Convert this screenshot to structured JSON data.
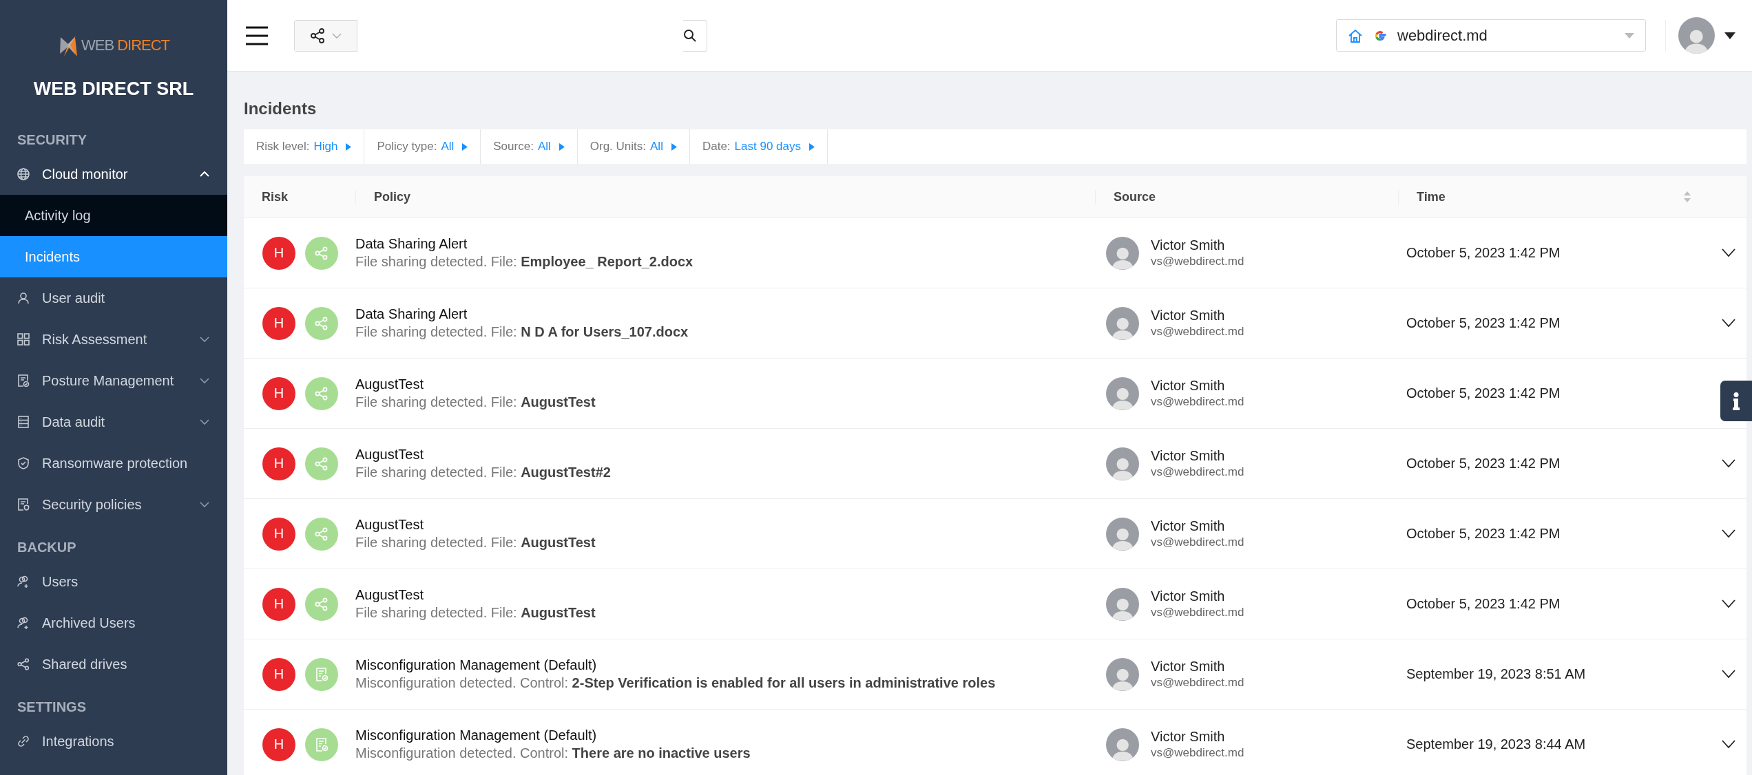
{
  "sidebar": {
    "logo": {
      "word_1": "WEB",
      "word_2": "DIRECT"
    },
    "company": "WEB DIRECT SRL",
    "items": [
      {
        "kind": "header",
        "label": "SECURITY"
      },
      {
        "kind": "item",
        "label": "Cloud monitor",
        "expanded": true
      },
      {
        "kind": "subitem",
        "label": "Activity log",
        "selected": false
      },
      {
        "kind": "subitem",
        "label": "Incidents",
        "selected": true
      },
      {
        "kind": "item",
        "label": "User audit"
      },
      {
        "kind": "item",
        "label": "Risk Assessment",
        "expanded": false
      },
      {
        "kind": "item",
        "label": "Posture Management",
        "expanded": false
      },
      {
        "kind": "item",
        "label": "Data audit",
        "expanded": false
      },
      {
        "kind": "item",
        "label": "Ransomware protection"
      },
      {
        "kind": "item",
        "label": "Security policies",
        "expanded": false
      },
      {
        "kind": "header",
        "label": "BACKUP"
      },
      {
        "kind": "item",
        "label": "Users"
      },
      {
        "kind": "item",
        "label": "Archived Users"
      },
      {
        "kind": "item",
        "label": "Shared drives"
      },
      {
        "kind": "header",
        "label": "SETTINGS"
      },
      {
        "kind": "item",
        "label": "Integrations"
      }
    ]
  },
  "topbar": {
    "domain": "webdirect.md"
  },
  "page_title": "Incidents",
  "filters": [
    {
      "label": "Risk level:",
      "value": "High"
    },
    {
      "label": "Policy type:",
      "value": "All"
    },
    {
      "label": "Source:",
      "value": "All"
    },
    {
      "label": "Org. Units:",
      "value": "All"
    },
    {
      "label": "Date:",
      "value": "Last 90 days"
    }
  ],
  "table": {
    "columns": [
      "Risk",
      "Policy",
      "Source",
      "Time"
    ],
    "rows": [
      {
        "kind": "sharing",
        "risk": "H",
        "title": "Data Sharing Alert",
        "detail": "File sharing detected. File: **Employee_ Report_2.docx**",
        "name": "Victor Smith",
        "email": "vs@webdirect.md",
        "time": "October 5, 2023 1:42 PM"
      },
      {
        "kind": "sharing",
        "risk": "H",
        "title": "Data Sharing Alert",
        "detail": "File sharing detected. File: **N D A for Users_107.docx**",
        "name": "Victor Smith",
        "email": "vs@webdirect.md",
        "time": "October 5, 2023 1:42 PM"
      },
      {
        "kind": "sharing",
        "risk": "H",
        "title": "AugustTest",
        "detail": "File sharing detected. File: **AugustTest**",
        "name": "Victor Smith",
        "email": "vs@webdirect.md",
        "time": "October 5, 2023 1:42 PM"
      },
      {
        "kind": "sharing",
        "risk": "H",
        "title": "AugustTest",
        "detail": "File sharing detected. File: **AugustTest#2**",
        "name": "Victor Smith",
        "email": "vs@webdirect.md",
        "time": "October 5, 2023 1:42 PM"
      },
      {
        "kind": "sharing",
        "risk": "H",
        "title": "AugustTest",
        "detail": "File sharing detected. File: **AugustTest**",
        "name": "Victor Smith",
        "email": "vs@webdirect.md",
        "time": "October 5, 2023 1:42 PM"
      },
      {
        "kind": "sharing",
        "risk": "H",
        "title": "AugustTest",
        "detail": "File sharing detected. File: **AugustTest**",
        "name": "Victor Smith",
        "email": "vs@webdirect.md",
        "time": "October 5, 2023 1:42 PM"
      },
      {
        "kind": "misconfiguration",
        "risk": "H",
        "title": "Misconfiguration Management (Default)",
        "detail": "Misconfiguration detected. Control: **2-Step Verification is enabled for all users in administrative roles**",
        "name": "Victor Smith",
        "email": "vs@webdirect.md",
        "time": "September 19, 2023 8:51 AM"
      },
      {
        "kind": "misconfiguration",
        "risk": "H",
        "title": "Misconfiguration Management (Default)",
        "detail": "Misconfiguration detected. Control: **There are no inactive users**",
        "name": "Victor Smith",
        "email": "vs@webdirect.md",
        "time": "September 19, 2023 8:44 AM"
      }
    ]
  }
}
